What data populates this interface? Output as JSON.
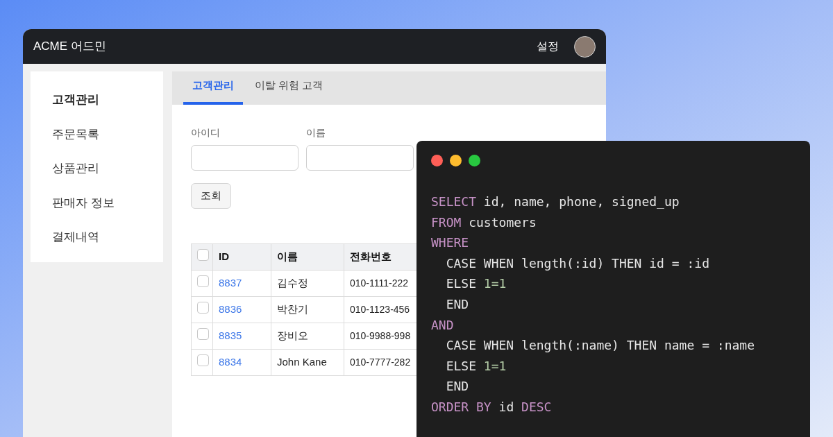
{
  "admin_window": {
    "title": "ACME 어드민",
    "settings": "설정",
    "sidebar": {
      "items": [
        {
          "label": "고객관리",
          "selected": true
        },
        {
          "label": "주문목록",
          "selected": false
        },
        {
          "label": "상품관리",
          "selected": false
        },
        {
          "label": "판매자 정보",
          "selected": false
        },
        {
          "label": "결제내역",
          "selected": false
        }
      ]
    },
    "tabs": [
      {
        "label": "고객관리",
        "selected": true
      },
      {
        "label": "이탈 위험 고객",
        "selected": false
      }
    ],
    "filters": [
      {
        "label": "아이디"
      },
      {
        "label": "이름"
      }
    ],
    "search_button": "조회",
    "table": {
      "header_checked": false,
      "columns": [
        "ID",
        "이름",
        "전화번호"
      ],
      "rows": [
        {
          "checked": false,
          "id": "8837",
          "name": "김수정",
          "phone": "010-1111-222"
        },
        {
          "checked": false,
          "id": "8836",
          "name": "박찬기",
          "phone": "010-1123-456"
        },
        {
          "checked": false,
          "id": "8835",
          "name": "장비오",
          "phone": "010-9988-998"
        },
        {
          "checked": false,
          "id": "8834",
          "name": "John Kane",
          "phone": "010-7777-282"
        }
      ]
    }
  },
  "code_window": {
    "lines": [
      [
        {
          "kind": "keyword",
          "text": "SELECT"
        },
        {
          "kind": "text",
          "text": " id, name, phone, signed_up"
        }
      ],
      [
        {
          "kind": "keyword",
          "text": "FROM"
        },
        {
          "kind": "text",
          "text": " customers"
        }
      ],
      [
        {
          "kind": "keyword",
          "text": "WHERE"
        }
      ],
      [
        {
          "kind": "text",
          "text": "  CASE WHEN length(:id) THEN id = :id"
        }
      ],
      [
        {
          "kind": "text",
          "text": "  ELSE "
        },
        {
          "kind": "number",
          "text": "1=1"
        }
      ],
      [
        {
          "kind": "text",
          "text": "  END"
        }
      ],
      [
        {
          "kind": "keyword",
          "text": "AND"
        }
      ],
      [
        {
          "kind": "text",
          "text": "  CASE WHEN length(:name) THEN name = :name"
        }
      ],
      [
        {
          "kind": "text",
          "text": "  ELSE "
        },
        {
          "kind": "number",
          "text": "1=1"
        }
      ],
      [
        {
          "kind": "text",
          "text": "  END"
        }
      ],
      [
        {
          "kind": "keyword",
          "text": "ORDER BY"
        },
        {
          "kind": "text",
          "text": " id "
        },
        {
          "kind": "keyword",
          "text": "DESC"
        }
      ]
    ]
  }
}
